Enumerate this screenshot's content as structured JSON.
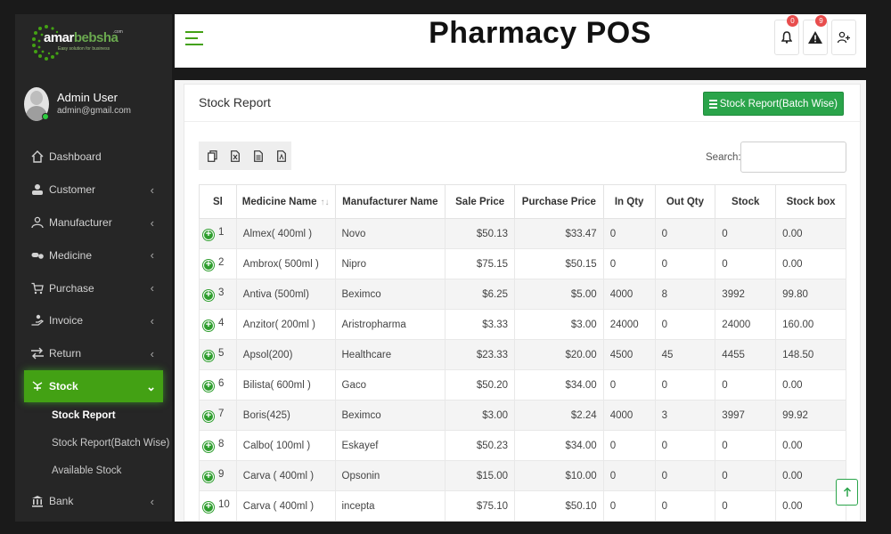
{
  "brand": {
    "name_a": "amar",
    "name_b": "bebsha",
    "sup": ".com",
    "tagline": "Easy solution for business"
  },
  "user": {
    "name": "Admin User",
    "email": "admin@gmail.com"
  },
  "nav": {
    "items": [
      {
        "label": "Dashboard",
        "icon": "home-icon"
      },
      {
        "label": "Customer",
        "icon": "customer-icon"
      },
      {
        "label": "Manufacturer",
        "icon": "manufacturer-icon"
      },
      {
        "label": "Medicine",
        "icon": "pill-icon"
      },
      {
        "label": "Purchase",
        "icon": "cart-icon"
      },
      {
        "label": "Invoice",
        "icon": "invoice-hand-icon"
      },
      {
        "label": "Return",
        "icon": "return-arrows-icon"
      },
      {
        "label": "Stock",
        "icon": "stock-icon"
      },
      {
        "label": "Bank",
        "icon": "bank-icon"
      }
    ],
    "stock_sub": [
      "Stock Report",
      "Stock Report(Batch Wise)",
      "Available Stock"
    ]
  },
  "header": {
    "title": "Pharmacy POS",
    "notifications_count": "0",
    "alerts_count": "9"
  },
  "page": {
    "title": "Stock Report",
    "batch_button": "Stock Report(Batch Wise)",
    "search_label": "Search:",
    "search_value": ""
  },
  "table": {
    "columns": [
      "Sl",
      "Medicine Name",
      "Manufacturer Name",
      "Sale Price",
      "Purchase Price",
      "In Qty",
      "Out Qty",
      "Stock",
      "Stock box"
    ],
    "rows": [
      [
        "1",
        "Almex( 400ml )",
        "Novo",
        "$50.13",
        "$33.47",
        "0",
        "0",
        "0",
        "0.00"
      ],
      [
        "2",
        "Ambrox( 500ml )",
        "Nipro",
        "$75.15",
        "$50.15",
        "0",
        "0",
        "0",
        "0.00"
      ],
      [
        "3",
        "Antiva (500ml)",
        "Beximco",
        "$6.25",
        "$5.00",
        "4000",
        "8",
        "3992",
        "99.80"
      ],
      [
        "4",
        "Anzitor( 200ml )",
        "Aristropharma",
        "$3.33",
        "$3.00",
        "24000",
        "0",
        "24000",
        "160.00"
      ],
      [
        "5",
        "Apsol(200)",
        "Healthcare",
        "$23.33",
        "$20.00",
        "4500",
        "45",
        "4455",
        "148.50"
      ],
      [
        "6",
        "Bilista( 600ml )",
        "Gaco",
        "$50.20",
        "$34.00",
        "0",
        "0",
        "0",
        "0.00"
      ],
      [
        "7",
        "Boris(425)",
        "Beximco",
        "$3.00",
        "$2.24",
        "4000",
        "3",
        "3997",
        "99.92"
      ],
      [
        "8",
        "Calbo( 100ml )",
        "Eskayef",
        "$50.23",
        "$34.00",
        "0",
        "0",
        "0",
        "0.00"
      ],
      [
        "9",
        "Carva ( 400ml )",
        "Opsonin",
        "$15.00",
        "$10.00",
        "0",
        "0",
        "0",
        "0.00"
      ],
      [
        "10",
        "Carva ( 400ml )",
        "incepta",
        "$75.10",
        "$50.10",
        "0",
        "0",
        "0",
        "0.00"
      ]
    ]
  },
  "colors": {
    "accent": "#43a114",
    "sidebar": "#262626",
    "button_green": "#2aa44a",
    "badge_red": "#e84d4d"
  }
}
